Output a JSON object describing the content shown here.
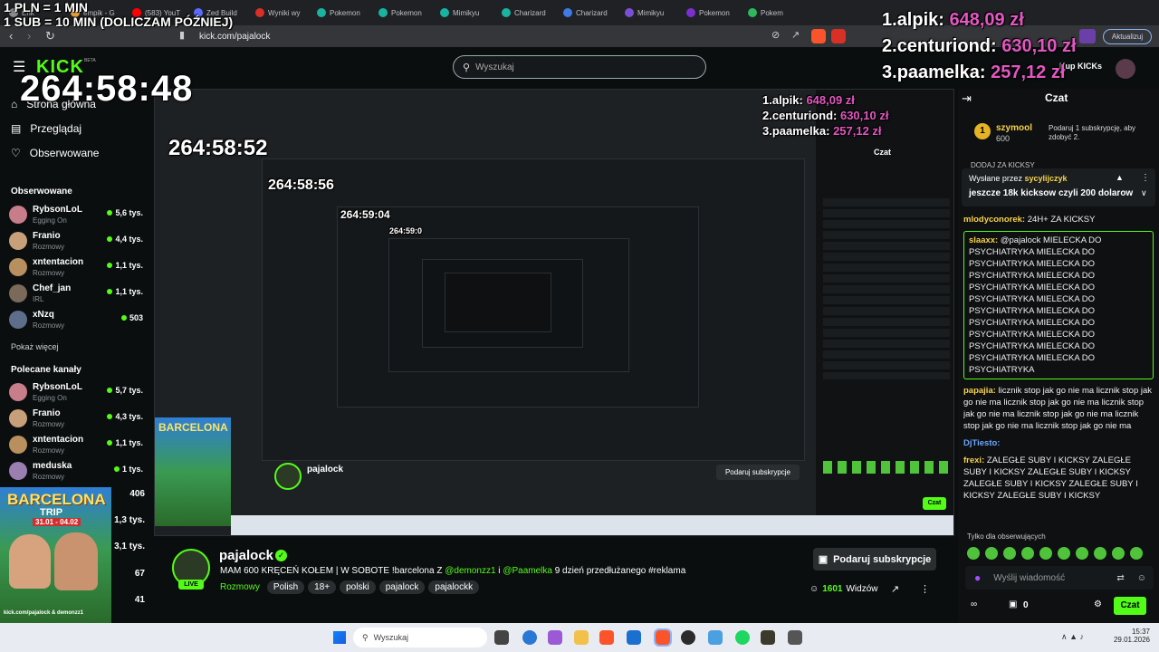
{
  "overlay": {
    "donation_line1": "1 PLN = 1 MIN",
    "donation_line2": "1 SUB = 10 MIN (DOLICZAM PÓŹNIEJ)",
    "timer": "264:58:48",
    "leaderboard": [
      {
        "rank": "1.",
        "name": "alpik:",
        "amount": "648,09 zł"
      },
      {
        "rank": "2.",
        "name": "centuriond:",
        "amount": "630,10 zł"
      },
      {
        "rank": "3.",
        "name": "paamelka:",
        "amount": "257,12 zł"
      }
    ],
    "nested_timers": [
      "264:58:52",
      "264:58:56",
      "264:59:04",
      "264:59:0"
    ]
  },
  "browser": {
    "tabs": [
      "Erik",
      "empik - G",
      "(583) YouT",
      "Zed Build",
      "Wyniki wy",
      "Pokemon",
      "Pokemon",
      "Mimikyu",
      "Charizard",
      "Charizard",
      "Mimikyu",
      "Pokemon",
      "Pokem"
    ],
    "tab_colors": [
      "#8a8d90",
      "#e8a23b",
      "#ff0000",
      "#5b6bff",
      "#d93025",
      "#19b3a1",
      "#19b3a1",
      "#19b3a1",
      "#19b3a1",
      "#3f7be6",
      "#7a4fd6",
      "#7a2fd1",
      "#2eb85c"
    ],
    "url": "kick.com/pajalock",
    "update_button": "Aktualizuj"
  },
  "header": {
    "logo": "KICK",
    "beta": "BETA",
    "search_placeholder": "Wyszukaj",
    "kicks_label": "Kup KICKs"
  },
  "sidebar": {
    "links": [
      "Strona główna",
      "Przeglądaj",
      "Obserwowane"
    ],
    "followed_title": "Obserwowane",
    "followed": [
      {
        "name": "RybsonLoL",
        "category": "Egging On",
        "viewers": "5,6 tys.",
        "color": "#c77d8a"
      },
      {
        "name": "Franio",
        "category": "Rozmowy",
        "viewers": "4,4 tys.",
        "color": "#c7a07a"
      },
      {
        "name": "xntentacion",
        "category": "Rozmowy",
        "viewers": "1,1 tys.",
        "color": "#b88f5e"
      },
      {
        "name": "Chef_jan",
        "category": "IRL",
        "viewers": "1,1 tys.",
        "color": "#7b6a5a"
      },
      {
        "name": "xNzq",
        "category": "Rozmowy",
        "viewers": "503",
        "color": "#5e6e8a"
      }
    ],
    "show_more": "Pokaż więcej",
    "recommended_title": "Polecane kanały",
    "recommended": [
      {
        "name": "RybsonLoL",
        "category": "Egging On",
        "viewers": "5,7 tys.",
        "color": "#c77d8a"
      },
      {
        "name": "Franio",
        "category": "Rozmowy",
        "viewers": "4,3 tys.",
        "color": "#c7a07a"
      },
      {
        "name": "xntentacion",
        "category": "Rozmowy",
        "viewers": "1,1 tys.",
        "color": "#b88f5e"
      },
      {
        "name": "meduska",
        "category": "Rozmowy",
        "viewers": "1 tys.",
        "color": "#9a7fb0"
      }
    ],
    "poster_counts": [
      "406",
      "1,3 tys.",
      "3,1 tys.",
      "67",
      "41"
    ]
  },
  "poster": {
    "title": "BARCELONA",
    "subtitle": "TRIP",
    "dates": "31.01 - 04.02",
    "footer": "kick.com/pajalock & demonzz1"
  },
  "streamer": {
    "name": "pajalock",
    "title_part1": "MAM 600 KRĘCEŃ KOŁEM | W SOBOTE !barcelona  Z ",
    "mention1": "@demonzz1",
    "and": " i ",
    "mention2": "@Paamelka",
    "title_part2": " 9 dzień przedłużanego #reklama",
    "category": "Rozmowy",
    "tags": [
      "Polish",
      "18+",
      "polski",
      "pajalock",
      "pajalockk"
    ],
    "live": "LIVE",
    "viewers": "1601",
    "viewers_label": "Widzów",
    "gift_button": "Podaruj subskrypcje"
  },
  "chat": {
    "title": "Czat",
    "top_gifter": {
      "name": "szymool",
      "points": "600",
      "prompt": "Podaruj 1 subskrypcję, aby zdobyć 2."
    },
    "pinned": {
      "label": "Wysłane przez",
      "author": "sycylijczyk",
      "text": "jeszcze 18k kicksow czyli 200 dolarow"
    },
    "partial_top": "DODAJ ZA KICKSY",
    "messages": [
      {
        "user": "mlodyconorek:",
        "text": " 24H+ ZA KICKSY",
        "color": "#f7d24a"
      },
      {
        "user": "slaaxx:",
        "text": " @pajalock MIELECKA DO PSYCHIATRYKA MIELECKA DO PSYCHIATRYKA MIELECKA DO PSYCHIATRYKA MIELECKA DO PSYCHIATRYKA MIELECKA DO PSYCHIATRYKA MIELECKA DO PSYCHIATRYKA MIELECKA DO PSYCHIATRYKA MIELECKA DO PSYCHIATRYKA MIELECKA DO PSYCHIATRYKA MIELECKA DO PSYCHIATRYKA MIELECKA DO PSYCHIATRYKA",
        "color": "#f7d24a"
      },
      {
        "user": "papajia:",
        "text": " licznik stop jak go nie ma licznik stop jak go nie ma licznik stop jak go nie ma licznik stop jak go nie ma licznik stop jak go nie ma licznik stop jak go nie ma licznik stop jak go nie ma",
        "color": "#f7d24a"
      },
      {
        "user": "DjTiesto:",
        "text": "",
        "color": "#6aa7ff"
      },
      {
        "user": "frexi:",
        "text": " ZALEGŁE SUBY I KICKSY ZALEGŁE SUBY I KICKSY ZALEGŁE SUBY I KICKSY ZALEGŁE SUBY I KICKSY ZALEGŁE SUBY I KICKSY ZALEGŁE SUBY I KICKSY",
        "color": "#f7d24a"
      }
    ],
    "followers_only": "Tylko dla obserwujących",
    "input_placeholder": "Wyślij wiadomość",
    "kick_count": "0",
    "send": "Czat"
  },
  "taskbar": {
    "search": "Wyszukaj",
    "time": "15:37",
    "date": "29.01.2026"
  }
}
